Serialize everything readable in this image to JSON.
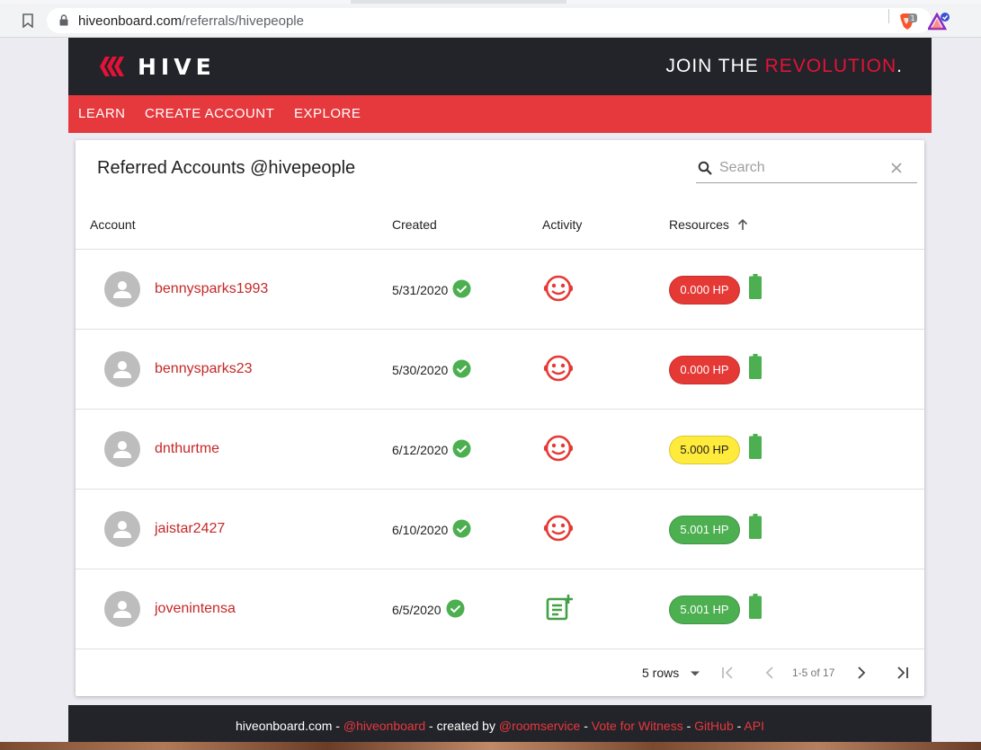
{
  "browser": {
    "url_host": "hiveonboard.com",
    "url_path": "/referrals/hivepeople",
    "brave_badge": "1"
  },
  "header": {
    "brand": "HIVE",
    "slogan_prefix": "JOIN THE ",
    "slogan_highlight": "REVOLUTION",
    "slogan_suffix": ".",
    "accent_color": "#e31337"
  },
  "nav": {
    "items": [
      "LEARN",
      "CREATE ACCOUNT",
      "EXPLORE"
    ]
  },
  "card": {
    "title": "Referred Accounts @hivepeople",
    "search": {
      "placeholder": "Search",
      "value": ""
    }
  },
  "table": {
    "columns": {
      "account": "Account",
      "created": "Created",
      "activity": "Activity",
      "resources": "Resources"
    },
    "sort": {
      "column": "Resources",
      "direction": "ascending",
      "icon": "arrow-up-icon"
    },
    "rows": [
      {
        "account": "bennysparks1993",
        "created": "5/31/2020",
        "activity_icon": "smiley-face-icon",
        "hp": "0.000 HP",
        "hp_color": "#e53935",
        "battery_icon": "battery-full-icon"
      },
      {
        "account": "bennysparks23",
        "created": "5/30/2020",
        "activity_icon": "smiley-face-icon",
        "hp": "0.000 HP",
        "hp_color": "#e53935",
        "battery_icon": "battery-full-icon"
      },
      {
        "account": "dnthurtme",
        "created": "6/12/2020",
        "activity_icon": "smiley-face-icon",
        "hp": "5.000 HP",
        "hp_color": "#ffeb3b",
        "battery_icon": "battery-full-icon"
      },
      {
        "account": "jaistar2427",
        "created": "6/10/2020",
        "activity_icon": "smiley-face-icon",
        "hp": "5.001 HP",
        "hp_color": "#4caf50",
        "battery_icon": "battery-full-icon"
      },
      {
        "account": "jovenintensa",
        "created": "6/5/2020",
        "activity_icon": "post-add-icon",
        "hp": "5.001 HP",
        "hp_color": "#4caf50",
        "battery_icon": "battery-full-icon"
      }
    ]
  },
  "pagination": {
    "rows_label": "5 rows",
    "range": "1-5 of 17"
  },
  "footer": {
    "site": "hiveonboard.com",
    "sep1": " - ",
    "handle": "@hiveonboard",
    "created_by": " - created by ",
    "author": "@roomservice",
    "sep2": " - ",
    "vote": "Vote for Witness",
    "sep3": " - ",
    "github": "GitHub",
    "sep4": " - ",
    "api": "API"
  }
}
